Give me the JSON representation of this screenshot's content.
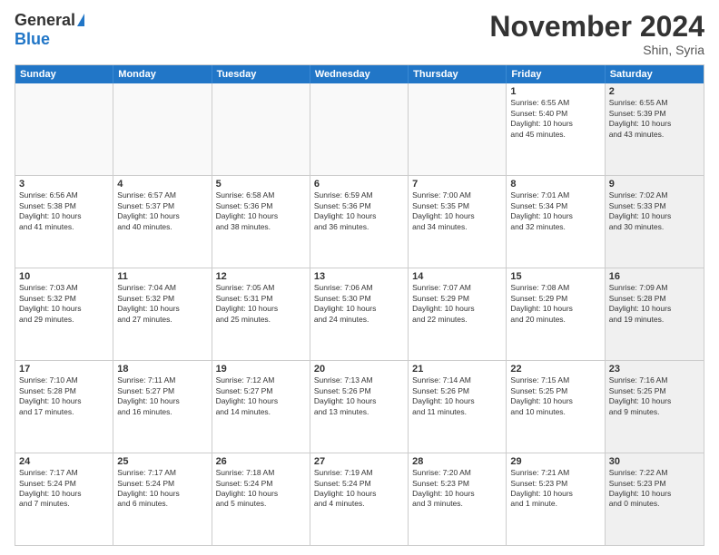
{
  "header": {
    "logo_general": "General",
    "logo_blue": "Blue",
    "month_title": "November 2024",
    "location": "Shin, Syria"
  },
  "calendar": {
    "days_of_week": [
      "Sunday",
      "Monday",
      "Tuesday",
      "Wednesday",
      "Thursday",
      "Friday",
      "Saturday"
    ],
    "weeks": [
      [
        {
          "day": "",
          "info": "",
          "empty": true
        },
        {
          "day": "",
          "info": "",
          "empty": true
        },
        {
          "day": "",
          "info": "",
          "empty": true
        },
        {
          "day": "",
          "info": "",
          "empty": true
        },
        {
          "day": "",
          "info": "",
          "empty": true
        },
        {
          "day": "1",
          "info": "Sunrise: 6:55 AM\nSunset: 5:40 PM\nDaylight: 10 hours\nand 45 minutes.",
          "empty": false
        },
        {
          "day": "2",
          "info": "Sunrise: 6:55 AM\nSunset: 5:39 PM\nDaylight: 10 hours\nand 43 minutes.",
          "empty": false,
          "shaded": true
        }
      ],
      [
        {
          "day": "3",
          "info": "Sunrise: 6:56 AM\nSunset: 5:38 PM\nDaylight: 10 hours\nand 41 minutes.",
          "empty": false
        },
        {
          "day": "4",
          "info": "Sunrise: 6:57 AM\nSunset: 5:37 PM\nDaylight: 10 hours\nand 40 minutes.",
          "empty": false
        },
        {
          "day": "5",
          "info": "Sunrise: 6:58 AM\nSunset: 5:36 PM\nDaylight: 10 hours\nand 38 minutes.",
          "empty": false
        },
        {
          "day": "6",
          "info": "Sunrise: 6:59 AM\nSunset: 5:36 PM\nDaylight: 10 hours\nand 36 minutes.",
          "empty": false
        },
        {
          "day": "7",
          "info": "Sunrise: 7:00 AM\nSunset: 5:35 PM\nDaylight: 10 hours\nand 34 minutes.",
          "empty": false
        },
        {
          "day": "8",
          "info": "Sunrise: 7:01 AM\nSunset: 5:34 PM\nDaylight: 10 hours\nand 32 minutes.",
          "empty": false
        },
        {
          "day": "9",
          "info": "Sunrise: 7:02 AM\nSunset: 5:33 PM\nDaylight: 10 hours\nand 30 minutes.",
          "empty": false,
          "shaded": true
        }
      ],
      [
        {
          "day": "10",
          "info": "Sunrise: 7:03 AM\nSunset: 5:32 PM\nDaylight: 10 hours\nand 29 minutes.",
          "empty": false
        },
        {
          "day": "11",
          "info": "Sunrise: 7:04 AM\nSunset: 5:32 PM\nDaylight: 10 hours\nand 27 minutes.",
          "empty": false
        },
        {
          "day": "12",
          "info": "Sunrise: 7:05 AM\nSunset: 5:31 PM\nDaylight: 10 hours\nand 25 minutes.",
          "empty": false
        },
        {
          "day": "13",
          "info": "Sunrise: 7:06 AM\nSunset: 5:30 PM\nDaylight: 10 hours\nand 24 minutes.",
          "empty": false
        },
        {
          "day": "14",
          "info": "Sunrise: 7:07 AM\nSunset: 5:29 PM\nDaylight: 10 hours\nand 22 minutes.",
          "empty": false
        },
        {
          "day": "15",
          "info": "Sunrise: 7:08 AM\nSunset: 5:29 PM\nDaylight: 10 hours\nand 20 minutes.",
          "empty": false
        },
        {
          "day": "16",
          "info": "Sunrise: 7:09 AM\nSunset: 5:28 PM\nDaylight: 10 hours\nand 19 minutes.",
          "empty": false,
          "shaded": true
        }
      ],
      [
        {
          "day": "17",
          "info": "Sunrise: 7:10 AM\nSunset: 5:28 PM\nDaylight: 10 hours\nand 17 minutes.",
          "empty": false
        },
        {
          "day": "18",
          "info": "Sunrise: 7:11 AM\nSunset: 5:27 PM\nDaylight: 10 hours\nand 16 minutes.",
          "empty": false
        },
        {
          "day": "19",
          "info": "Sunrise: 7:12 AM\nSunset: 5:27 PM\nDaylight: 10 hours\nand 14 minutes.",
          "empty": false
        },
        {
          "day": "20",
          "info": "Sunrise: 7:13 AM\nSunset: 5:26 PM\nDaylight: 10 hours\nand 13 minutes.",
          "empty": false
        },
        {
          "day": "21",
          "info": "Sunrise: 7:14 AM\nSunset: 5:26 PM\nDaylight: 10 hours\nand 11 minutes.",
          "empty": false
        },
        {
          "day": "22",
          "info": "Sunrise: 7:15 AM\nSunset: 5:25 PM\nDaylight: 10 hours\nand 10 minutes.",
          "empty": false
        },
        {
          "day": "23",
          "info": "Sunrise: 7:16 AM\nSunset: 5:25 PM\nDaylight: 10 hours\nand 9 minutes.",
          "empty": false,
          "shaded": true
        }
      ],
      [
        {
          "day": "24",
          "info": "Sunrise: 7:17 AM\nSunset: 5:24 PM\nDaylight: 10 hours\nand 7 minutes.",
          "empty": false
        },
        {
          "day": "25",
          "info": "Sunrise: 7:17 AM\nSunset: 5:24 PM\nDaylight: 10 hours\nand 6 minutes.",
          "empty": false
        },
        {
          "day": "26",
          "info": "Sunrise: 7:18 AM\nSunset: 5:24 PM\nDaylight: 10 hours\nand 5 minutes.",
          "empty": false
        },
        {
          "day": "27",
          "info": "Sunrise: 7:19 AM\nSunset: 5:24 PM\nDaylight: 10 hours\nand 4 minutes.",
          "empty": false
        },
        {
          "day": "28",
          "info": "Sunrise: 7:20 AM\nSunset: 5:23 PM\nDaylight: 10 hours\nand 3 minutes.",
          "empty": false
        },
        {
          "day": "29",
          "info": "Sunrise: 7:21 AM\nSunset: 5:23 PM\nDaylight: 10 hours\nand 1 minute.",
          "empty": false
        },
        {
          "day": "30",
          "info": "Sunrise: 7:22 AM\nSunset: 5:23 PM\nDaylight: 10 hours\nand 0 minutes.",
          "empty": false,
          "shaded": true
        }
      ]
    ]
  }
}
